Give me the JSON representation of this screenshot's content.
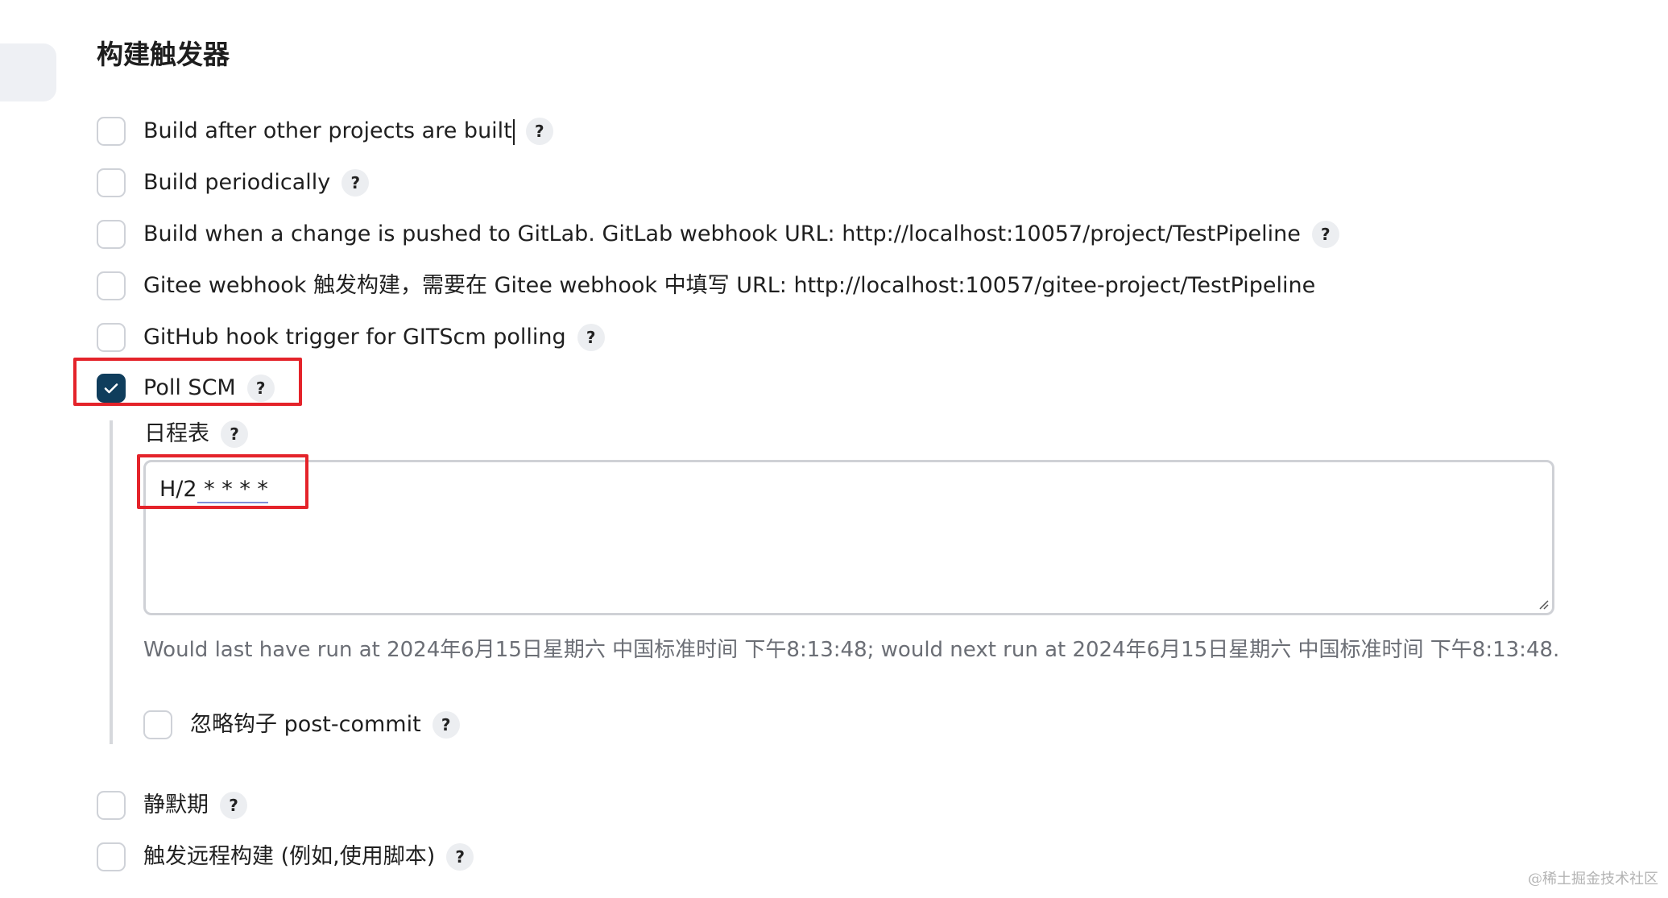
{
  "section": {
    "title": "构建触发器"
  },
  "triggers": [
    {
      "label": "Build after other projects are built",
      "checked": false,
      "has_help": true
    },
    {
      "label": "Build periodically",
      "checked": false,
      "has_help": true
    },
    {
      "label": "Build when a change is pushed to GitLab. GitLab webhook URL: http://localhost:10057/project/TestPipeline",
      "checked": false,
      "has_help": true
    },
    {
      "label": "Gitee webhook 触发构建，需要在 Gitee webhook 中填写 URL: http://localhost:10057/gitee-project/TestPipeline",
      "checked": false,
      "has_help": false
    },
    {
      "label": "GitHub hook trigger for GITScm polling",
      "checked": false,
      "has_help": true
    },
    {
      "label": "Poll SCM",
      "checked": true,
      "has_help": true
    }
  ],
  "poll_scm": {
    "schedule_label": "日程表",
    "schedule_value_prefix": "H/2",
    "schedule_value_suffix": " * * * *",
    "hint": "Would last have run at 2024年6月15日星期六 中国标准时间 下午8:13:48; would next run at 2024年6月15日星期六 中国标准时间 下午8:13:48.",
    "ignore_post_commit_label": "忽略钩子 post-commit",
    "ignore_post_commit_checked": false
  },
  "more_triggers": [
    {
      "label": "静默期",
      "checked": false
    },
    {
      "label": "触发远程构建 (例如,使用脚本)",
      "checked": false
    }
  ],
  "help_glyph": "?",
  "watermark": "@稀土掘金技术社区",
  "colors": {
    "checkbox_checked": "#0f3d5c",
    "highlight": "#e4232a",
    "hint_text": "#6b6e75"
  }
}
